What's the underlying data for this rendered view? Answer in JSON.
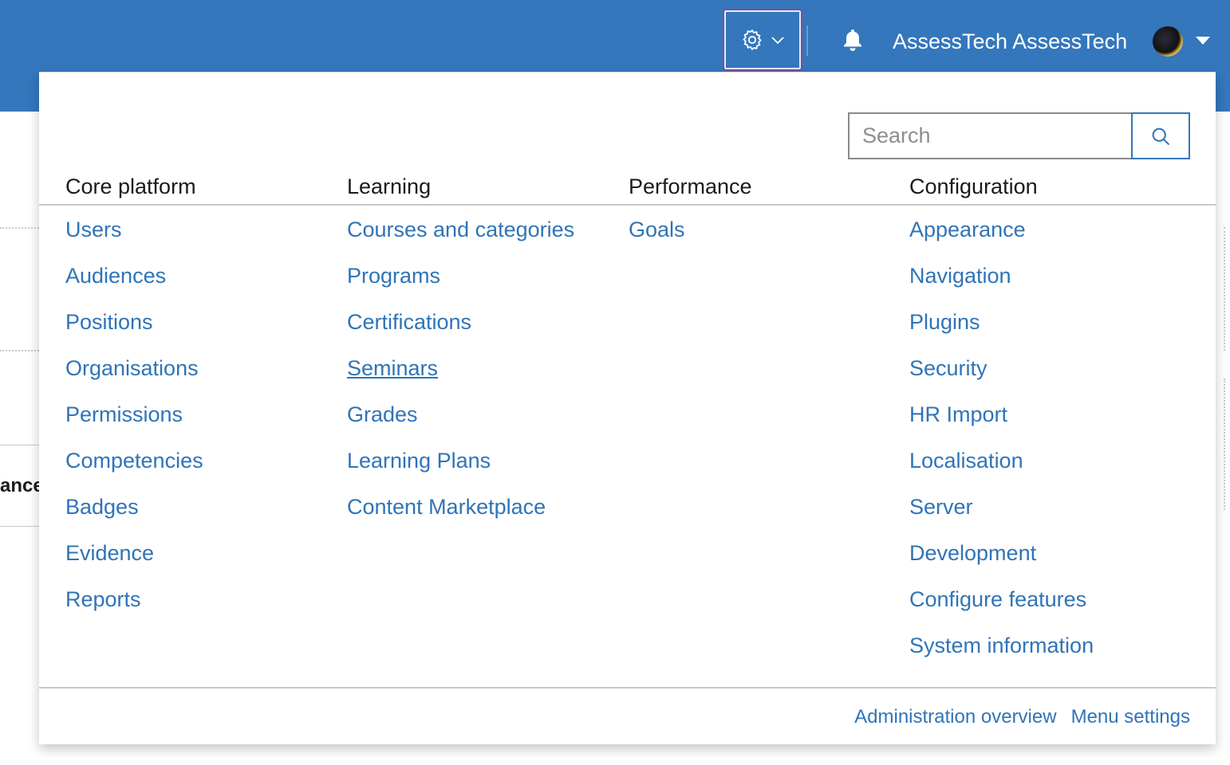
{
  "header": {
    "user_name": "AssessTech AssessTech",
    "admin_menu_icon": "gear-icon",
    "notifications_icon": "bell-icon"
  },
  "background": {
    "partial_text": "ance"
  },
  "admin_menu": {
    "search_placeholder": "Search",
    "columns": [
      {
        "heading": "Core platform",
        "items": [
          "Users",
          "Audiences",
          "Positions",
          "Organisations",
          "Permissions",
          "Competencies",
          "Badges",
          "Evidence",
          "Reports"
        ]
      },
      {
        "heading": "Learning",
        "items": [
          "Courses and categories",
          "Programs",
          "Certifications",
          "Seminars",
          "Grades",
          "Learning Plans",
          "Content Marketplace"
        ]
      },
      {
        "heading": "Performance",
        "items": [
          "Goals"
        ]
      },
      {
        "heading": "Configuration",
        "items": [
          "Appearance",
          "Navigation",
          "Plugins",
          "Security",
          "HR Import",
          "Localisation",
          "Server",
          "Development",
          "Configure features",
          "System information"
        ]
      }
    ],
    "footer": {
      "overview_label": "Administration overview",
      "settings_label": "Menu settings"
    }
  },
  "colors": {
    "topbar": "#3477bc",
    "link": "#2f74b8",
    "focus_border": "#7a4fa5"
  }
}
